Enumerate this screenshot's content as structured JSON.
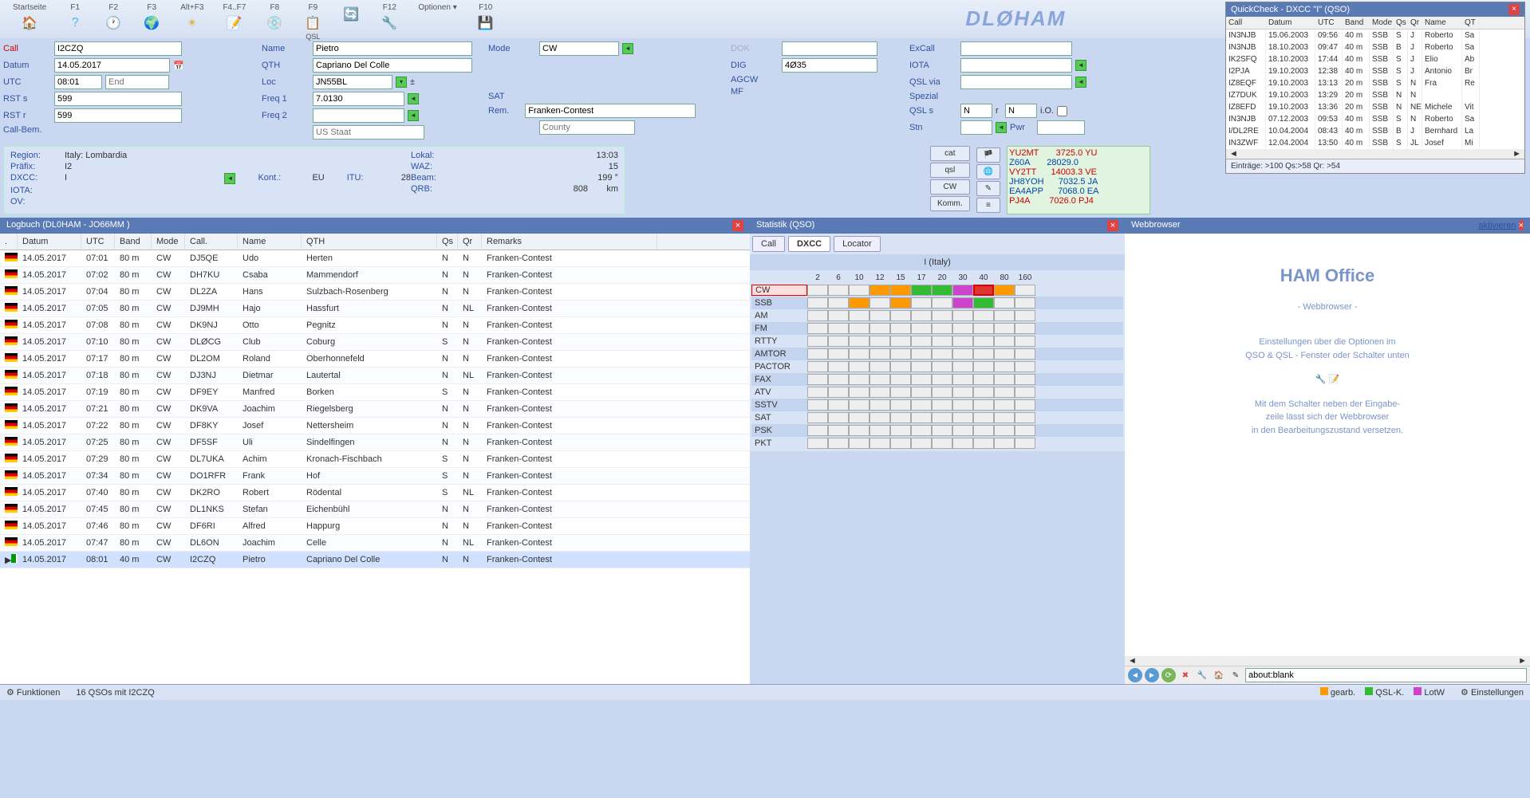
{
  "toolbar": {
    "items": [
      {
        "key": "Startseite",
        "icon": "🏠",
        "color": "#f7a94b"
      },
      {
        "key": "F1",
        "icon": "?",
        "color": "#5bb3e8"
      },
      {
        "key": "F2",
        "icon": "🕐",
        "color": "#ccc"
      },
      {
        "key": "F3",
        "icon": "🌍",
        "color": "#4a90d9"
      },
      {
        "key": "Alt+F3",
        "icon": "✴",
        "color": "#d9b84a"
      },
      {
        "key": "F4..F7",
        "icon": "📝",
        "color": "#8aa"
      },
      {
        "key": "F8",
        "icon": "💿",
        "color": "#c97"
      },
      {
        "key": "F9",
        "icon": "📋",
        "sub": "QSL",
        "color": "#79c"
      },
      {
        "key": "",
        "icon": "🔄",
        "color": "#e88"
      },
      {
        "key": "F12",
        "icon": "🔧",
        "color": "#aaa"
      },
      {
        "key": "Optionen ▾",
        "icon": "",
        "color": ""
      },
      {
        "key": "F10",
        "icon": "💾",
        "color": "#6c6"
      }
    ],
    "brand": "DLØHAM"
  },
  "quickcheck": {
    "title": "QuickCheck - DXCC \"I\" (QSO)",
    "cols": [
      "Call",
      "Datum",
      "UTC",
      "Band",
      "Mode",
      "Qs",
      "Qr",
      "Name",
      "QT"
    ],
    "rows": [
      [
        "IN3NJB",
        "15.06.2003",
        "09:56",
        "40 m",
        "SSB",
        "S",
        "J",
        "Roberto",
        "Sa"
      ],
      [
        "IN3NJB",
        "18.10.2003",
        "09:47",
        "40 m",
        "SSB",
        "B",
        "J",
        "Roberto",
        "Sa"
      ],
      [
        "IK2SFQ",
        "18.10.2003",
        "17:44",
        "40 m",
        "SSB",
        "S",
        "J",
        "Elio",
        "Ab"
      ],
      [
        "I2PJA",
        "19.10.2003",
        "12:38",
        "40 m",
        "SSB",
        "S",
        "J",
        "Antonio",
        "Br"
      ],
      [
        "IZ8EQF",
        "19.10.2003",
        "13:13",
        "20 m",
        "SSB",
        "S",
        "N",
        "Fra",
        "Re"
      ],
      [
        "IZ7DUK",
        "19.10.2003",
        "13:29",
        "20 m",
        "SSB",
        "N",
        "N",
        "",
        ""
      ],
      [
        "IZ8EFD",
        "19.10.2003",
        "13:36",
        "20 m",
        "SSB",
        "N",
        "NE",
        "Michele",
        "Vit"
      ],
      [
        "IN3NJB",
        "07.12.2003",
        "09:53",
        "40 m",
        "SSB",
        "S",
        "N",
        "Roberto",
        "Sa"
      ],
      [
        "I/DL2RE",
        "10.04.2004",
        "08:43",
        "40 m",
        "SSB",
        "B",
        "J",
        "Bernhard",
        "La"
      ],
      [
        "IN3ZWF",
        "12.04.2004",
        "13:50",
        "40 m",
        "SSB",
        "S",
        "JL",
        "Josef",
        "Mi"
      ]
    ],
    "footer": "Einträge:  >100   Qs:>58     Qr: >54"
  },
  "form": {
    "labels": {
      "call": "Call",
      "datum": "Datum",
      "utc": "UTC",
      "end": "End",
      "rsts": "RST s",
      "rstr": "RST r",
      "callbem": "Call-Bem.",
      "name": "Name",
      "qth": "QTH",
      "loc": "Loc",
      "freq1": "Freq 1",
      "freq2": "Freq 2",
      "mode": "Mode",
      "sat": "SAT",
      "rem": "Rem.",
      "usstaat": "US Staat",
      "county": "County",
      "dok": "DOK",
      "dig": "DIG",
      "agcw": "AGCW",
      "mf": "MF",
      "excall": "ExCall",
      "iota": "IOTA",
      "qslvia": "QSL via",
      "spezial": "Spezial",
      "qsls": "QSL s",
      "r": "r",
      "io": "i.O.",
      "stn": "Stn",
      "pwr": "Pwr"
    },
    "values": {
      "call": "I2CZQ",
      "datum": "14.05.2017",
      "utc": "08:01",
      "rsts": "599",
      "rstr": "599",
      "name": "Pietro",
      "qth": "Capriano Del Colle",
      "loc": "JN55BL",
      "freq1": "7.0130",
      "freq2": "",
      "mode": "CW",
      "rem": "Franken-Contest",
      "dig": "4Ø35",
      "qsls_s": "N",
      "qsls_r": "N"
    }
  },
  "info": {
    "region_lbl": "Region:",
    "region": "Italy: Lombardia",
    "prefix_lbl": "Präfix:",
    "prefix": "I2",
    "dxcc_lbl": "DXCC:",
    "dxcc": "I",
    "iota_lbl": "IOTA:",
    "ov_lbl": "OV:",
    "kont_lbl": "Kont.:",
    "kont": "EU",
    "itu_lbl": "ITU:",
    "itu": "28",
    "lokal_lbl": "Lokal:",
    "lokal": "13:03",
    "waz_lbl": "WAZ:",
    "waz": "15",
    "beam_lbl": "Beam:",
    "beam": "199  °",
    "qrb_lbl": "QRB:",
    "qrb": "808",
    "qrb_unit": "km",
    "btns": [
      "cat",
      "qsl",
      "CW",
      "Komm."
    ]
  },
  "cluster": [
    {
      "call": "YU2MT",
      "freq": "3725.0",
      "sfx": "YU",
      "cls": "red"
    },
    {
      "call": "Z60A",
      "freq": "28029.0",
      "sfx": "",
      "cls": "blue"
    },
    {
      "call": "VY2TT",
      "freq": "14003.3",
      "sfx": "VE",
      "cls": "red"
    },
    {
      "call": "JH8YOH",
      "freq": "7032.5",
      "sfx": "JA",
      "cls": "blue"
    },
    {
      "call": "EA4APP",
      "freq": "7068.0",
      "sfx": "EA",
      "cls": "blue"
    },
    {
      "call": "PJ4A",
      "freq": "7026.0",
      "sfx": "PJ4",
      "cls": "red"
    }
  ],
  "logbook": {
    "title": "Logbuch  (DL0HAM - JO66MM )",
    "cols": [
      ".",
      "Datum",
      "UTC",
      "Band",
      "Mode",
      "Call.",
      "Name",
      "QTH",
      "Qs",
      "Qr",
      "Remarks"
    ],
    "rows": [
      {
        "flag": "de",
        "d": "14.05.2017",
        "u": "07:01",
        "b": "80 m",
        "m": "CW",
        "c": "DJ5QE",
        "n": "Udo",
        "q": "Herten",
        "qs": "N",
        "qr": "N",
        "r": "Franken-Contest"
      },
      {
        "flag": "de",
        "d": "14.05.2017",
        "u": "07:02",
        "b": "80 m",
        "m": "CW",
        "c": "DH7KU",
        "n": "Csaba",
        "q": "Mammendorf",
        "qs": "N",
        "qr": "N",
        "r": "Franken-Contest"
      },
      {
        "flag": "de",
        "d": "14.05.2017",
        "u": "07:04",
        "b": "80 m",
        "m": "CW",
        "c": "DL2ZA",
        "n": "Hans",
        "q": "Sulzbach-Rosenberg",
        "qs": "N",
        "qr": "N",
        "r": "Franken-Contest"
      },
      {
        "flag": "de",
        "d": "14.05.2017",
        "u": "07:05",
        "b": "80 m",
        "m": "CW",
        "c": "DJ9MH",
        "n": "Hajo",
        "q": "Hassfurt",
        "qs": "N",
        "qr": "NL",
        "r": "Franken-Contest"
      },
      {
        "flag": "de",
        "d": "14.05.2017",
        "u": "07:08",
        "b": "80 m",
        "m": "CW",
        "c": "DK9NJ",
        "n": "Otto",
        "q": "Pegnitz",
        "qs": "N",
        "qr": "N",
        "r": "Franken-Contest"
      },
      {
        "flag": "de",
        "d": "14.05.2017",
        "u": "07:10",
        "b": "80 m",
        "m": "CW",
        "c": "DLØCG",
        "n": "Club",
        "q": "Coburg",
        "qs": "S",
        "qr": "N",
        "r": "Franken-Contest"
      },
      {
        "flag": "de",
        "d": "14.05.2017",
        "u": "07:17",
        "b": "80 m",
        "m": "CW",
        "c": "DL2OM",
        "n": "Roland",
        "q": "Oberhonnefeld",
        "qs": "N",
        "qr": "N",
        "r": "Franken-Contest"
      },
      {
        "flag": "de",
        "d": "14.05.2017",
        "u": "07:18",
        "b": "80 m",
        "m": "CW",
        "c": "DJ3NJ",
        "n": "Dietmar",
        "q": "Lautertal",
        "qs": "N",
        "qr": "NL",
        "r": "Franken-Contest"
      },
      {
        "flag": "de",
        "d": "14.05.2017",
        "u": "07:19",
        "b": "80 m",
        "m": "CW",
        "c": "DF9EY",
        "n": "Manfred",
        "q": "Borken",
        "qs": "S",
        "qr": "N",
        "r": "Franken-Contest"
      },
      {
        "flag": "de",
        "d": "14.05.2017",
        "u": "07:21",
        "b": "80 m",
        "m": "CW",
        "c": "DK9VA",
        "n": "Joachim",
        "q": "Riegelsberg",
        "qs": "N",
        "qr": "N",
        "r": "Franken-Contest"
      },
      {
        "flag": "de",
        "d": "14.05.2017",
        "u": "07:22",
        "b": "80 m",
        "m": "CW",
        "c": "DF8KY",
        "n": "Josef",
        "q": "Nettersheim",
        "qs": "N",
        "qr": "N",
        "r": "Franken-Contest"
      },
      {
        "flag": "de",
        "d": "14.05.2017",
        "u": "07:25",
        "b": "80 m",
        "m": "CW",
        "c": "DF5SF",
        "n": "Uli",
        "q": "Sindelfingen",
        "qs": "N",
        "qr": "N",
        "r": "Franken-Contest"
      },
      {
        "flag": "de",
        "d": "14.05.2017",
        "u": "07:29",
        "b": "80 m",
        "m": "CW",
        "c": "DL7UKA",
        "n": "Achim",
        "q": "Kronach-Fischbach",
        "qs": "S",
        "qr": "N",
        "r": "Franken-Contest"
      },
      {
        "flag": "de",
        "d": "14.05.2017",
        "u": "07:34",
        "b": "80 m",
        "m": "CW",
        "c": "DO1RFR",
        "n": "Frank",
        "q": "Hof",
        "qs": "S",
        "qr": "N",
        "r": "Franken-Contest"
      },
      {
        "flag": "de",
        "d": "14.05.2017",
        "u": "07:40",
        "b": "80 m",
        "m": "CW",
        "c": "DK2RO",
        "n": "Robert",
        "q": "Rödental",
        "qs": "S",
        "qr": "NL",
        "r": "Franken-Contest"
      },
      {
        "flag": "de",
        "d": "14.05.2017",
        "u": "07:45",
        "b": "80 m",
        "m": "CW",
        "c": "DL1NKS",
        "n": "Stefan",
        "q": "Eichenbühl",
        "qs": "N",
        "qr": "N",
        "r": "Franken-Contest"
      },
      {
        "flag": "de",
        "d": "14.05.2017",
        "u": "07:46",
        "b": "80 m",
        "m": "CW",
        "c": "DF6RI",
        "n": "Alfred",
        "q": "Happurg",
        "qs": "N",
        "qr": "N",
        "r": "Franken-Contest"
      },
      {
        "flag": "de",
        "d": "14.05.2017",
        "u": "07:47",
        "b": "80 m",
        "m": "CW",
        "c": "DL6ON",
        "n": "Joachim",
        "q": "Celle",
        "qs": "N",
        "qr": "NL",
        "r": "Franken-Contest"
      },
      {
        "flag": "it",
        "d": "14.05.2017",
        "u": "08:01",
        "b": "40 m",
        "m": "CW",
        "c": "I2CZQ",
        "n": "Pietro",
        "q": "Capriano Del Colle",
        "qs": "N",
        "qr": "N",
        "r": "Franken-Contest",
        "sel": true,
        "arrow": true
      }
    ]
  },
  "stats": {
    "title": "Statistik (QSO)",
    "tabs": [
      "Call",
      "DXCC",
      "Locator"
    ],
    "active_tab": "DXCC",
    "country": "I (Italy)",
    "bands": [
      "2",
      "6",
      "10",
      "12",
      "15",
      "17",
      "20",
      "30",
      "40",
      "80",
      "160"
    ],
    "modes": [
      "CW",
      "SSB",
      "AM",
      "FM",
      "RTTY",
      "AMTOR",
      "PACTOR",
      "FAX",
      "ATV",
      "SSTV",
      "SAT",
      "PSK",
      "PKT"
    ],
    "cells": {
      "CW": [
        "",
        "",
        "",
        "o",
        "o",
        "g",
        "g",
        "p",
        "rhl",
        "o",
        ""
      ],
      "SSB": [
        "",
        "",
        "o",
        "",
        "o",
        "",
        "",
        "p",
        "g",
        "",
        ""
      ]
    }
  },
  "browser": {
    "title": "Webbrowser",
    "activate": "aktivieren",
    "h": "HAM Office",
    "sub": "- Webbrowser -",
    "p1": "Einstellungen über die Optionen im",
    "p2": "QSO & QSL - Fenster oder Schalter unten",
    "p3": "Mit dem Schalter neben der Eingabe-",
    "p4": "zeile lässt sich der Webbrowser",
    "p5": "in den Bearbeitungszustand versetzen.",
    "url": "about:blank"
  },
  "status": {
    "funk": "Funktionen",
    "count": "16 QSOs mit I2CZQ",
    "gearb": "gearb.",
    "qslk": "QSL-K.",
    "lotw": "LotW",
    "einst": "Einstellungen"
  }
}
